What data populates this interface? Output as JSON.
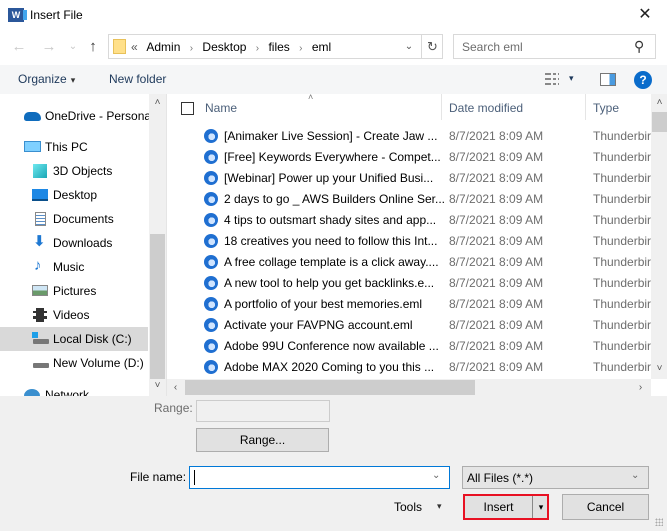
{
  "window": {
    "title": "Insert File",
    "app_icon_letter": "W",
    "close_glyph": "✕"
  },
  "nav": {
    "back_glyph": "←",
    "forward_glyph": "→",
    "recent_glyph": "⌄",
    "up_glyph": "↑",
    "breadcrumb_prefix": "«",
    "breadcrumb": [
      "Admin",
      "Desktop",
      "files",
      "eml"
    ],
    "breadcrumb_sep": "›",
    "dropdown_glyph": "⌄",
    "refresh_glyph": "↻",
    "search_placeholder": "Search eml",
    "search_glyph": "⚲"
  },
  "toolbar": {
    "organize_label": "Organize",
    "caret": "▾",
    "new_folder_label": "New folder",
    "help_label": "?"
  },
  "sidebar": {
    "scroll_up": "˄",
    "scroll_down": "˅",
    "items": [
      {
        "label": "OneDrive - Personal",
        "icon": "onedrive-icon"
      },
      {
        "label": "This PC",
        "icon": "this-pc-icon"
      },
      {
        "label": "3D Objects",
        "icon": "3d-objects-icon"
      },
      {
        "label": "Desktop",
        "icon": "desktop-icon"
      },
      {
        "label": "Documents",
        "icon": "documents-icon"
      },
      {
        "label": "Downloads",
        "icon": "downloads-icon"
      },
      {
        "label": "Music",
        "icon": "music-icon"
      },
      {
        "label": "Pictures",
        "icon": "pictures-icon"
      },
      {
        "label": "Videos",
        "icon": "videos-icon"
      },
      {
        "label": "Local Disk (C:)",
        "icon": "local-disk-icon",
        "selected": true
      },
      {
        "label": "New Volume (D:)",
        "icon": "drive-icon"
      },
      {
        "label": "Network",
        "icon": "network-icon"
      }
    ]
  },
  "filelist": {
    "sort_glyph": "˄",
    "columns": {
      "name": "Name",
      "date": "Date modified",
      "type": "Type"
    },
    "rows": [
      {
        "name": "[Animaker Live Session] - Create Jaw ...",
        "date": "8/7/2021 8:09 AM",
        "type": "Thunderbir"
      },
      {
        "name": "[Free] Keywords Everywhere - Compet...",
        "date": "8/7/2021 8:09 AM",
        "type": "Thunderbir"
      },
      {
        "name": "[Webinar] Power up your Unified Busi...",
        "date": "8/7/2021 8:09 AM",
        "type": "Thunderbir"
      },
      {
        "name": "2 days to go _ AWS Builders Online Ser...",
        "date": "8/7/2021 8:09 AM",
        "type": "Thunderbir"
      },
      {
        "name": "4 tips to outsmart shady sites and app...",
        "date": "8/7/2021 8:09 AM",
        "type": "Thunderbir"
      },
      {
        "name": "18 creatives you need to follow this Int...",
        "date": "8/7/2021 8:09 AM",
        "type": "Thunderbir"
      },
      {
        "name": "A free collage template is a click away....",
        "date": "8/7/2021 8:09 AM",
        "type": "Thunderbir"
      },
      {
        "name": "A new tool to help you get backlinks.e...",
        "date": "8/7/2021 8:09 AM",
        "type": "Thunderbir"
      },
      {
        "name": "A portfolio of your best memories.eml",
        "date": "8/7/2021 8:09 AM",
        "type": "Thunderbir"
      },
      {
        "name": "Activate your FAVPNG account.eml",
        "date": "8/7/2021 8:09 AM",
        "type": "Thunderbir"
      },
      {
        "name": "Adobe 99U Conference now available ...",
        "date": "8/7/2021 8:09 AM",
        "type": "Thunderbir"
      },
      {
        "name": "Adobe MAX 2020 Coming to you this ...",
        "date": "8/7/2021 8:09 AM",
        "type": "Thunderbir"
      }
    ],
    "scroll_up": "˄",
    "scroll_down": "˅",
    "scroll_left": "‹",
    "scroll_right": "›"
  },
  "bottom": {
    "range_label": "Range:",
    "range_value": "",
    "range_button": "Range...",
    "filename_label": "File name:",
    "filename_value": "",
    "dropdown_glyph": "⌄",
    "filetype_value": "All Files (*.*)",
    "tools_label": "Tools",
    "caret": "▾",
    "insert_label": "Insert",
    "cancel_label": "Cancel"
  },
  "colors": {
    "accent": "#0078d7",
    "insert_highlight": "#e81123",
    "help_blue": "#0a6ccb",
    "selected_bg": "#d9d9d9"
  }
}
